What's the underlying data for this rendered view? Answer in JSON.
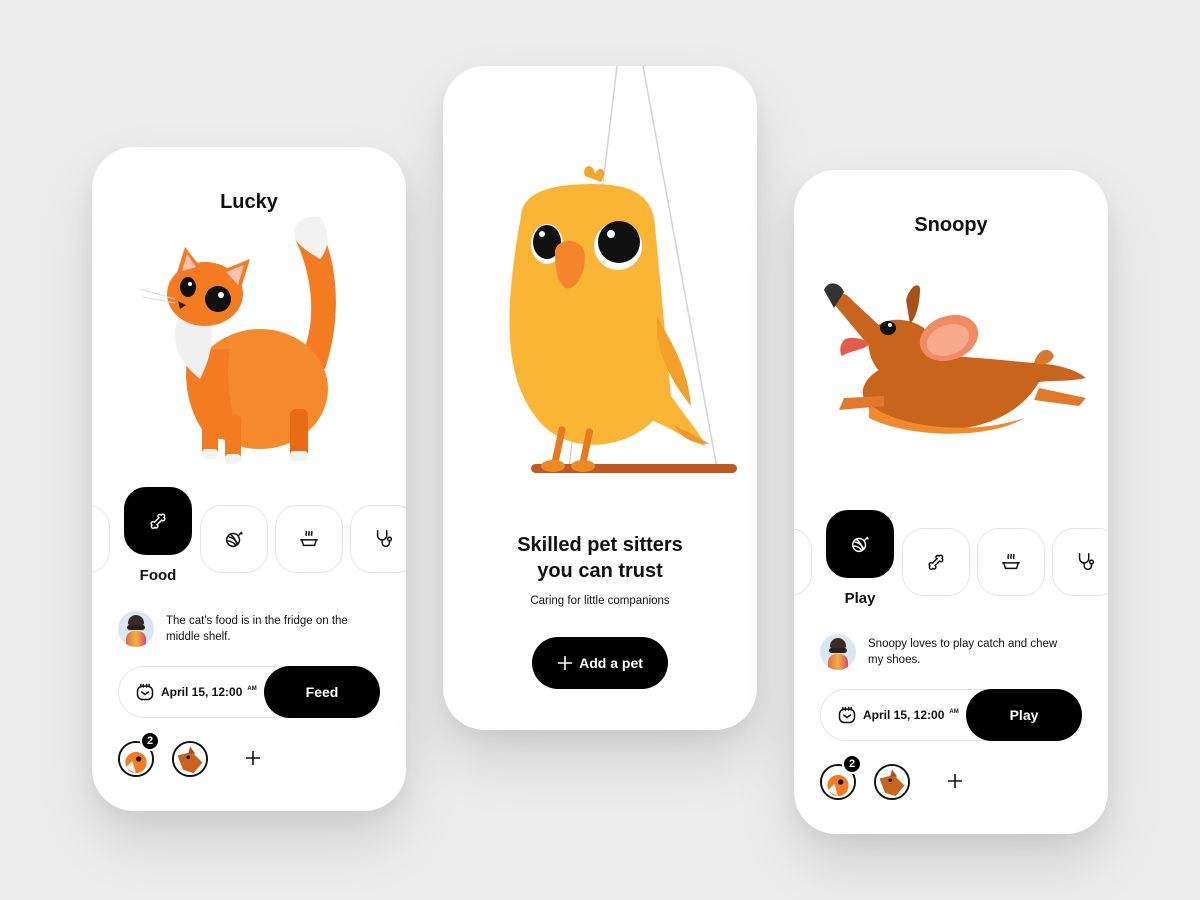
{
  "cards": {
    "lucky": {
      "pet_name": "Lucky",
      "active_category": "Food",
      "categories": [
        "food",
        "play",
        "bowl",
        "vet"
      ],
      "note": "The cat's food is in the fridge on the middle shelf.",
      "date": "April 15, 12:00",
      "meridiem": "AM",
      "action_label": "Feed",
      "badge_count": "2"
    },
    "bird": {
      "headline_line1": "Skilled pet sitters",
      "headline_line2": "you can trust",
      "subline": "Caring for little companions",
      "add_label": "Add a pet"
    },
    "snoopy": {
      "pet_name": "Snoopy",
      "active_category": "Play",
      "categories": [
        "play",
        "food",
        "bowl",
        "vet"
      ],
      "note": "Snoopy loves to play catch and chew my shoes.",
      "date": "April 15, 12:00",
      "meridiem": "AM",
      "action_label": "Play",
      "badge_count": "2"
    }
  },
  "colors": {
    "background": "#ededed",
    "card": "#ffffff",
    "accent": "#000000",
    "cat_orange": "#f47b20",
    "bird_yellow": "#fbb534",
    "dog_brown": "#c9641d"
  }
}
